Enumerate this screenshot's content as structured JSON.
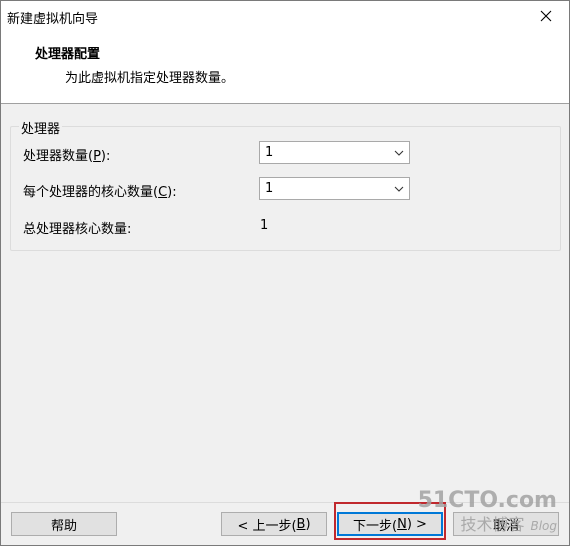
{
  "window": {
    "title": "新建虚拟机向导"
  },
  "header": {
    "title": "处理器配置",
    "subtitle": "为此虚拟机指定处理器数量。"
  },
  "group": {
    "label": "处理器",
    "rows": [
      {
        "label_pre": "处理器数量(",
        "label_key": "P",
        "label_post": "):",
        "value": "1"
      },
      {
        "label_pre": "每个处理器的核心数量(",
        "label_key": "C",
        "label_post": "):",
        "value": "1"
      },
      {
        "label": "总处理器核心数量:",
        "value": "1"
      }
    ]
  },
  "footer": {
    "help": "帮助",
    "back_pre": "< 上一步(",
    "back_key": "B",
    "back_post": ")",
    "next_pre": "下一步(",
    "next_key": "N",
    "next_post": ") >",
    "cancel": "取消"
  },
  "watermark": {
    "site": "51CTO.com",
    "tagline": "技术博客",
    "blog": "Blog"
  },
  "colors": {
    "accent": "#0078d7",
    "highlight": "#c0282d"
  }
}
